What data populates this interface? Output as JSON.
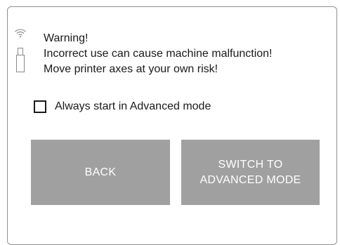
{
  "status": {
    "wifi_icon": "wifi-icon",
    "usb_icon": "usb-drive-icon"
  },
  "message": {
    "line1": "Warning!",
    "line2": "Incorrect use can cause machine malfunction!",
    "line3": "Move printer axes at your own risk!"
  },
  "checkbox": {
    "label": "Always start in Advanced mode",
    "checked": false
  },
  "buttons": {
    "back_label": "BACK",
    "advanced_line1": "SWITCH TO",
    "advanced_line2": "ADVANCED MODE"
  },
  "colors": {
    "button_bg": "#a0a0a0",
    "button_text": "#ffffff",
    "border": "#8f8f8f"
  }
}
